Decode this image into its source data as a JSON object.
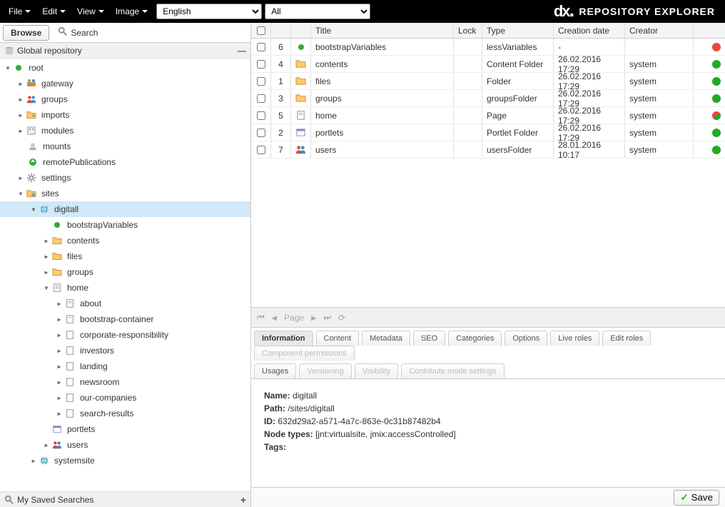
{
  "topbar": {
    "menus": [
      "File",
      "Edit",
      "View",
      "Image"
    ],
    "languageSelect": "English",
    "workspaceSelect": "All",
    "brand": "REPOSITORY EXPLORER"
  },
  "toolbar": {
    "browse": "Browse",
    "search": "Search"
  },
  "repoHeader": "Global repository",
  "tree": {
    "root": "root",
    "nodes": {
      "gateway": "gateway",
      "groups": "groups",
      "imports": "imports",
      "modules": "modules",
      "mounts": "mounts",
      "remotePublications": "remotePublications",
      "settings": "settings",
      "sites": "sites",
      "digitall": "digitall",
      "bootstrapVariables": "bootstrapVariables",
      "contents": "contents",
      "files": "files",
      "groups2": "groups",
      "home": "home",
      "about": "about",
      "bootstrapContainer": "bootstrap-container",
      "corporateResponsibility": "corporate-responsibility",
      "investors": "investors",
      "landing": "landing",
      "newsroom": "newsroom",
      "ourCompanies": "our-companies",
      "searchResults": "search-results",
      "portlets": "portlets",
      "users": "users",
      "systemsite": "systemsite"
    }
  },
  "savedSearches": "My Saved Searches",
  "grid": {
    "headers": {
      "title": "Title",
      "lock": "Lock",
      "type": "Type",
      "creationDate": "Creation date",
      "creator": "Creator"
    },
    "rows": [
      {
        "num": "6",
        "title": "bootstrapVariables",
        "type": "lessVariables",
        "date": "-",
        "creator": "",
        "status": "red",
        "icon": "dot"
      },
      {
        "num": "4",
        "title": "contents",
        "type": "Content Folder",
        "date": "26.02.2016 17:29",
        "creator": "system",
        "status": "green",
        "icon": "folder"
      },
      {
        "num": "1",
        "title": "files",
        "type": "Folder",
        "date": "26.02.2016 17:29",
        "creator": "system",
        "status": "green",
        "icon": "folder"
      },
      {
        "num": "3",
        "title": "groups",
        "type": "groupsFolder",
        "date": "26.02.2016 17:29",
        "creator": "system",
        "status": "green",
        "icon": "folder"
      },
      {
        "num": "5",
        "title": "home",
        "type": "Page",
        "date": "26.02.2016 17:29",
        "creator": "system",
        "status": "orange",
        "icon": "page"
      },
      {
        "num": "2",
        "title": "portlets",
        "type": "Portlet Folder",
        "date": "26.02.2016 17:29",
        "creator": "system",
        "status": "green",
        "icon": "portlet"
      },
      {
        "num": "7",
        "title": "users",
        "type": "usersFolder",
        "date": "28.01.2016 10:17",
        "creator": "system",
        "status": "green",
        "icon": "users"
      }
    ]
  },
  "pager": {
    "page": "Page"
  },
  "tabs": {
    "information": "Information",
    "content": "Content",
    "metadata": "Metadata",
    "seo": "SEO",
    "categories": "Categories",
    "options": "Options",
    "liveRoles": "Live roles",
    "editRoles": "Edit roles",
    "componentPermissions": "Component permissions",
    "usages": "Usages",
    "versioning": "Versioning",
    "visibility": "Visibility",
    "contributeMode": "Contribute mode settings"
  },
  "info": {
    "nameLabel": "Name:",
    "nameValue": "digitall",
    "pathLabel": "Path:",
    "pathValue": "/sites/digitall",
    "idLabel": "ID:",
    "idValue": "632d29a2-a571-4a7c-863e-0c31b87482b4",
    "nodeTypesLabel": "Node types:",
    "nodeTypesValue": "[jnt:virtualsite, jmix:accessControlled]",
    "tagsLabel": "Tags:"
  },
  "save": "Save"
}
